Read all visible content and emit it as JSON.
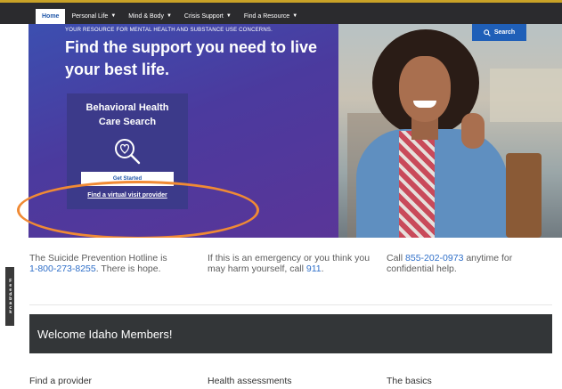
{
  "nav": {
    "items": [
      {
        "label": "Home",
        "active": true,
        "dropdown": false
      },
      {
        "label": "Personal Life",
        "active": false,
        "dropdown": true
      },
      {
        "label": "Mind & Body",
        "active": false,
        "dropdown": true
      },
      {
        "label": "Crisis Support",
        "active": false,
        "dropdown": true
      },
      {
        "label": "Find a Resource",
        "active": false,
        "dropdown": true
      }
    ]
  },
  "hero": {
    "tagline": "YOUR RESOURCE FOR MENTAL HEALTH AND SUBSTANCE USE CONCERNS.",
    "headline": "Find the support you need to live your best life.",
    "search_label": "Search",
    "care_card": {
      "title": "Behavioral Health\nCare Search",
      "icon": "magnifier-heart-icon",
      "button_label": "Get Started",
      "link_label": "Find a virtual visit provider"
    }
  },
  "info": {
    "hotline_text": "The Suicide Prevention Hotline is",
    "hotline_number": "1-800-273-8255",
    "hotline_suffix": ". There is hope.",
    "emergency_text": "If this is an emergency or you think you may harm yourself, call ",
    "emergency_number": "911",
    "emergency_suffix": ".",
    "call_prefix": "Call ",
    "call_number": "855-202-0973",
    "call_suffix": " anytime for confidential help."
  },
  "feedback_label": "Feedback",
  "welcome": {
    "text": "Welcome Idaho Members!"
  },
  "bottom": {
    "find_provider": "Find a provider",
    "health_assessments": "Health assessments",
    "basics": "The basics"
  },
  "colors": {
    "brand_blue": "#1f56a8",
    "link_blue": "#2f6fc9",
    "highlight_orange": "#f08a34",
    "dark_banner": "#333638"
  }
}
